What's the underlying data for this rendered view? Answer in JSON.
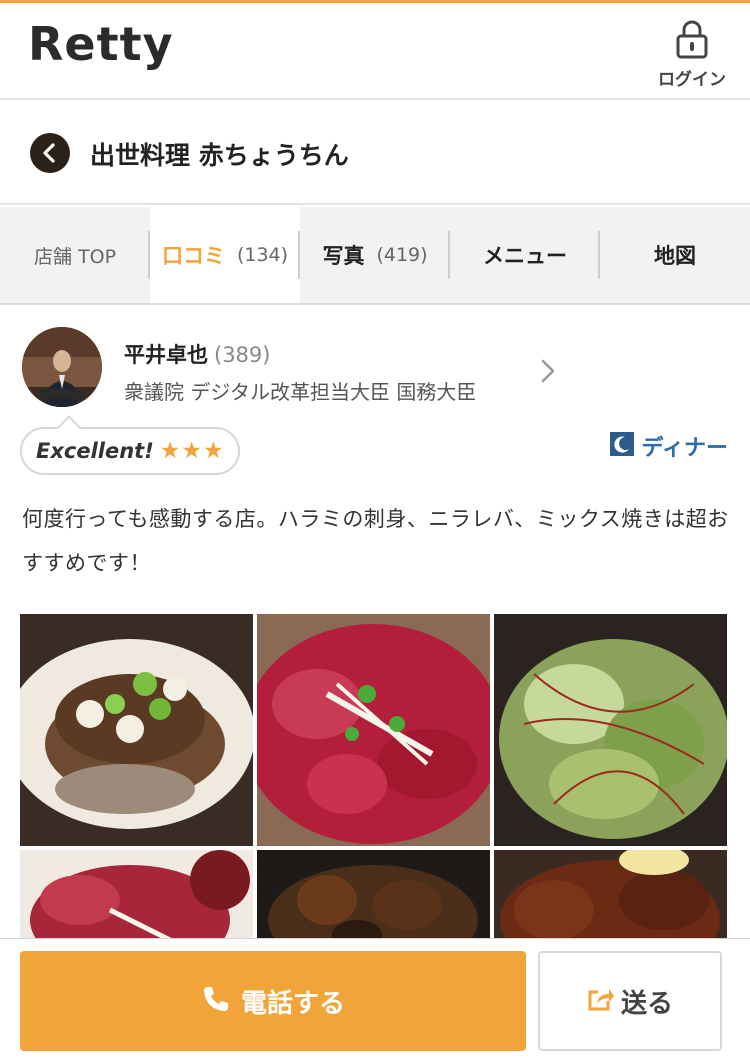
{
  "header": {
    "logo": "Retty",
    "login_label": "ログイン",
    "login_icon": "lock-icon"
  },
  "shop": {
    "back_icon": "chevron-left-icon",
    "name": "出世料理 赤ちょうちん"
  },
  "tabs": [
    {
      "label": "店舗 TOP",
      "count": ""
    },
    {
      "label": "口コミ",
      "count": "(134)"
    },
    {
      "label": "写真",
      "count": "(419)"
    },
    {
      "label": "メニュー",
      "count": ""
    },
    {
      "label": "地図",
      "count": ""
    }
  ],
  "review": {
    "user_name": "平井卓也",
    "user_count": "(389)",
    "user_title": "衆議院 デジタル改革担当大臣 国務大臣",
    "badge": "Excellent!",
    "stars": 3,
    "meal_time": "ディナー",
    "meal_icon": "moon-icon",
    "text": "何度行っても感動する店。ハラミの刺身、ニラレバ、ミックス焼きは超おすすめです！",
    "photos": [
      "food-photo",
      "food-photo",
      "food-photo",
      "food-photo",
      "food-photo",
      "food-photo"
    ]
  },
  "actions": {
    "call_label": "電話する",
    "call_icon": "phone-icon",
    "send_label": "送る",
    "send_icon": "share-icon"
  },
  "colors": {
    "accent": "#f0a43a",
    "dinner": "#2e6ca8"
  }
}
